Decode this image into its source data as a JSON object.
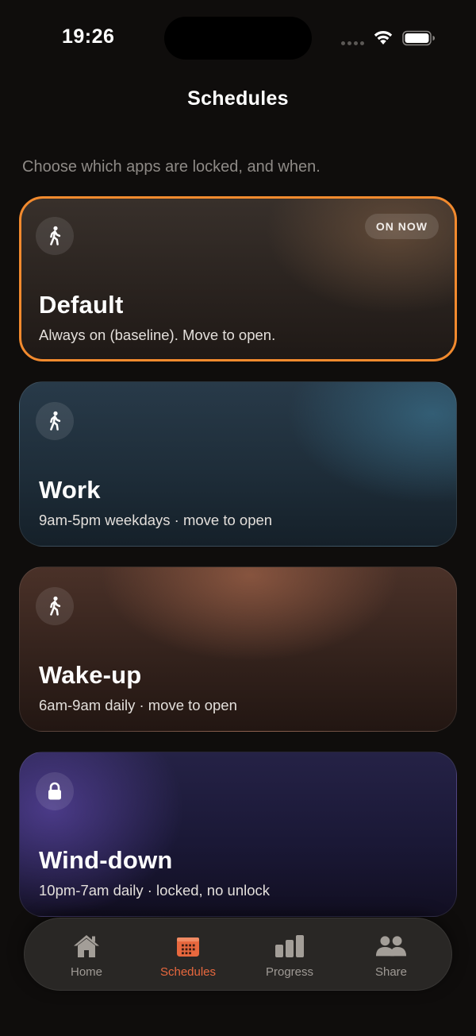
{
  "status_bar": {
    "time": "19:26"
  },
  "header": {
    "title": "Schedules",
    "subtitle": "Choose which apps are locked, and when."
  },
  "schedules": [
    {
      "name": "Default",
      "description": "Always on (baseline). Move to open.",
      "icon": "walking-icon",
      "badge": "ON NOW",
      "active": true
    },
    {
      "name": "Work",
      "description": "9am-5pm weekdays · move to open",
      "icon": "walking-icon"
    },
    {
      "name": "Wake-up",
      "description": "6am-9am daily · move to open",
      "icon": "walking-icon"
    },
    {
      "name": "Wind-down",
      "description": "10pm-7am daily · locked, no unlock",
      "icon": "lock-icon"
    }
  ],
  "tab_bar": {
    "tabs": [
      {
        "label": "Home",
        "icon": "home-icon"
      },
      {
        "label": "Schedules",
        "icon": "calendar-icon",
        "active": true
      },
      {
        "label": "Progress",
        "icon": "bar-chart-icon"
      },
      {
        "label": "Share",
        "icon": "people-icon"
      }
    ]
  },
  "colors": {
    "background": "#0f0d0c",
    "accent": "#f28a2e",
    "active_tab": "#e8683e",
    "inactive_tab": "#9f9a95"
  }
}
